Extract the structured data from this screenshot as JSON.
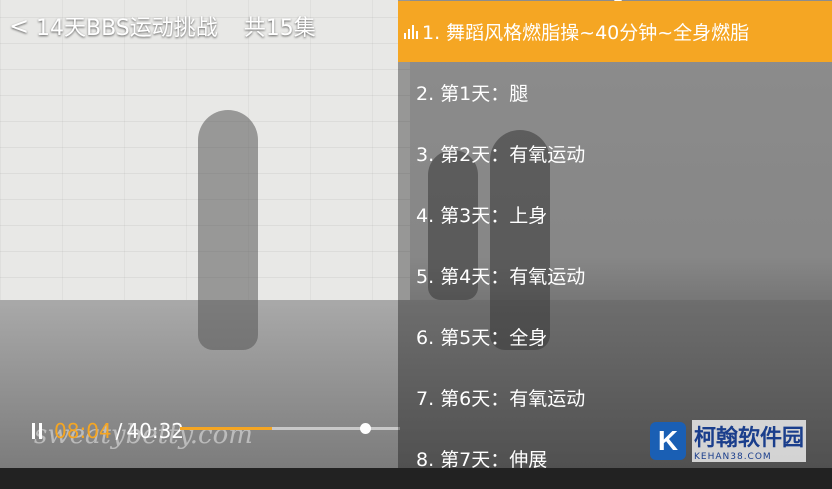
{
  "header": {
    "back_glyph": "<",
    "title": "14天BBS运动挑战",
    "episode_count": "共15集"
  },
  "player": {
    "current_time": "08:04",
    "separator": "/",
    "duration": "40:32",
    "progress": 0.2,
    "watermark": "sweatybetty.com"
  },
  "playlist": {
    "items": [
      {
        "label": "1. 舞蹈风格燃脂操~40分钟~全身燃脂",
        "active": true
      },
      {
        "label": "2. 第1天：腿"
      },
      {
        "label": "3. 第2天：有氧运动"
      },
      {
        "label": "4. 第3天：上身"
      },
      {
        "label": "5. 第4天：有氧运动"
      },
      {
        "label": "6. 第5天：全身"
      },
      {
        "label": "7. 第6天：有氧运动"
      },
      {
        "label": "8. 第7天：伸展"
      }
    ]
  },
  "logo": {
    "mark": "K",
    "name": "柯翰软件园",
    "domain": "KEHAN38.COM"
  },
  "colors": {
    "accent": "#f5a623",
    "logo_blue": "#1a5fb4"
  }
}
